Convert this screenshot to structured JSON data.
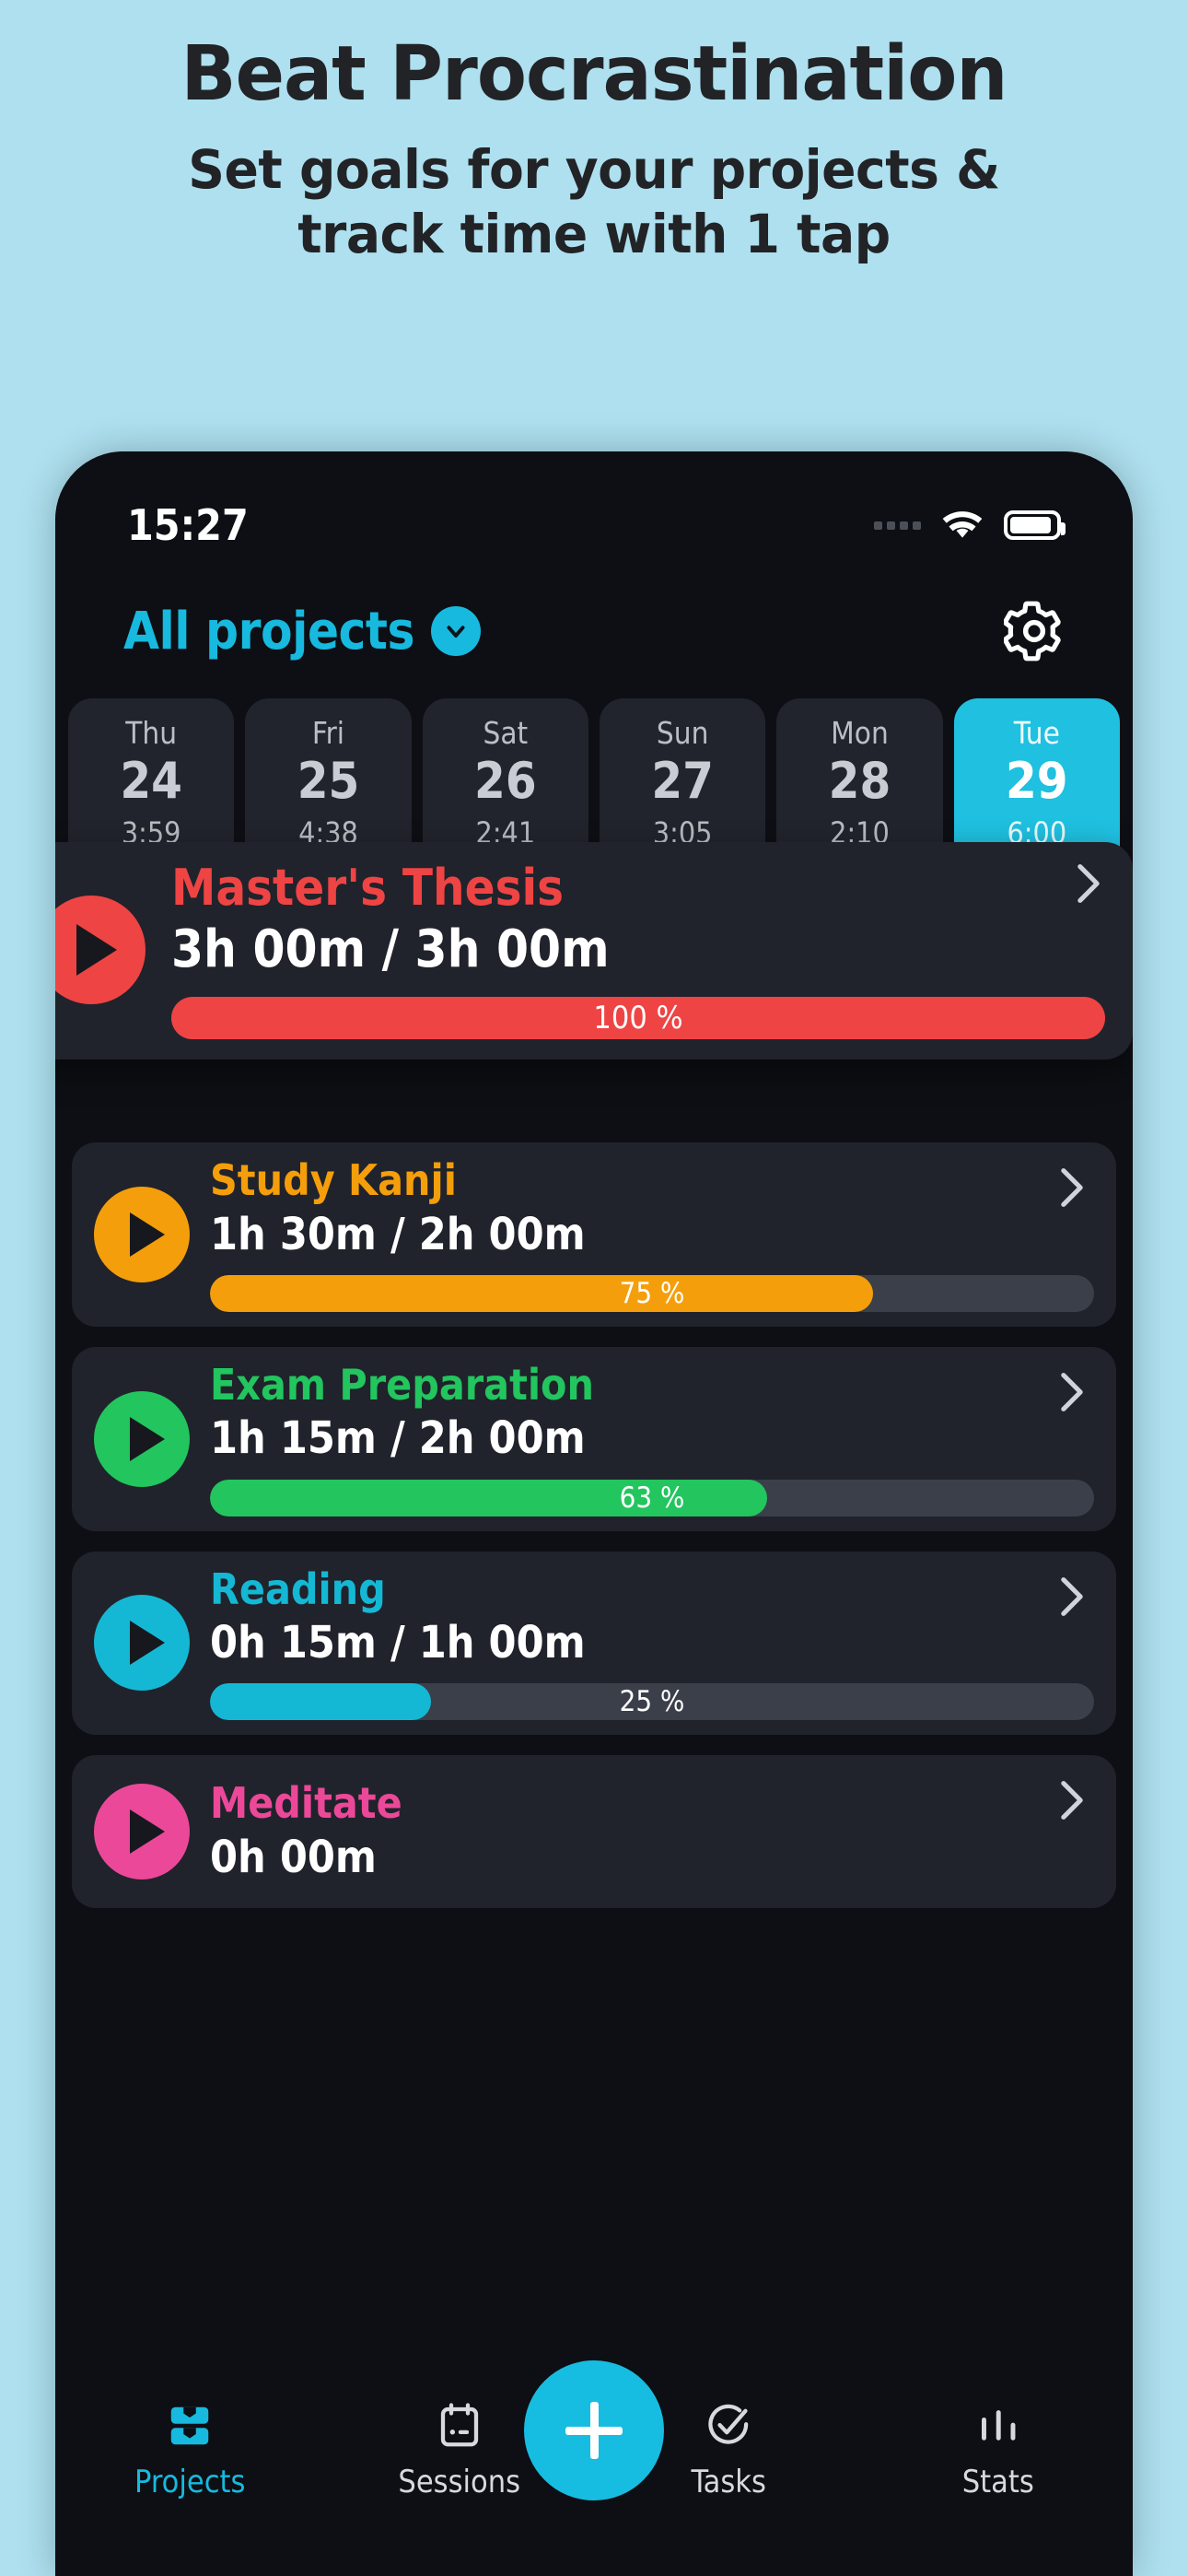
{
  "promo": {
    "title": "Beat Procrastination",
    "subtitle_line1": "Set goals for your projects &",
    "subtitle_line2": "track time with 1 tap",
    "background": "#aee0ef",
    "text_color": "#222326"
  },
  "status_bar": {
    "time": "15:27",
    "signal_icon": "signal-dots-icon",
    "wifi_icon": "wifi-icon",
    "battery_icon": "battery-icon"
  },
  "header": {
    "filter_label": "All projects",
    "filter_chevron_icon": "chevron-down-icon",
    "settings_icon": "gear-icon",
    "accent": "#17b9df"
  },
  "day_strip": [
    {
      "name": "Thu",
      "date": "24",
      "duration": "3:59",
      "active": false
    },
    {
      "name": "Fri",
      "date": "25",
      "duration": "4:38",
      "active": false
    },
    {
      "name": "Sat",
      "date": "26",
      "duration": "2:41",
      "active": false
    },
    {
      "name": "Sun",
      "date": "27",
      "duration": "3:05",
      "active": false
    },
    {
      "name": "Mon",
      "date": "28",
      "duration": "2:10",
      "active": false
    },
    {
      "name": "Tue",
      "date": "29",
      "duration": "6:00",
      "active": true
    }
  ],
  "projects": [
    {
      "name": "Master's Thesis",
      "time": "3h 00m / 3h 00m",
      "percent_label": "100 %",
      "percent": 100,
      "color": "#ef4444",
      "play_icon": "play-icon",
      "chevron_icon": "chevron-right-icon",
      "featured": true
    },
    {
      "name": "Study Kanji",
      "time": "1h 30m / 2h 00m",
      "percent_label": "75 %",
      "percent": 75,
      "color": "#f59e0b",
      "play_icon": "play-icon",
      "chevron_icon": "chevron-right-icon",
      "featured": false
    },
    {
      "name": "Exam Preparation",
      "time": "1h 15m / 2h 00m",
      "percent_label": "63 %",
      "percent": 63,
      "color": "#22c55e",
      "play_icon": "play-icon",
      "chevron_icon": "chevron-right-icon",
      "featured": false
    },
    {
      "name": "Reading",
      "time": "0h 15m / 1h 00m",
      "percent_label": "25 %",
      "percent": 25,
      "color": "#14b8d4",
      "play_icon": "play-icon",
      "chevron_icon": "chevron-right-icon",
      "featured": false
    },
    {
      "name": "Meditate",
      "time": "0h 00m",
      "percent_label": "",
      "percent": null,
      "color": "#ec4899",
      "play_icon": "play-icon",
      "chevron_icon": "chevron-right-icon",
      "featured": false
    }
  ],
  "bottom_nav": {
    "items": [
      {
        "label": "Projects",
        "icon": "projects-icon",
        "active": true
      },
      {
        "label": "Sessions",
        "icon": "sessions-icon",
        "active": false
      },
      {
        "label": "Tasks",
        "icon": "tasks-check-icon",
        "active": false
      },
      {
        "label": "Stats",
        "icon": "stats-bars-icon",
        "active": false
      }
    ],
    "add_button_icon": "plus-icon",
    "add_button_color": "#17bde0"
  }
}
